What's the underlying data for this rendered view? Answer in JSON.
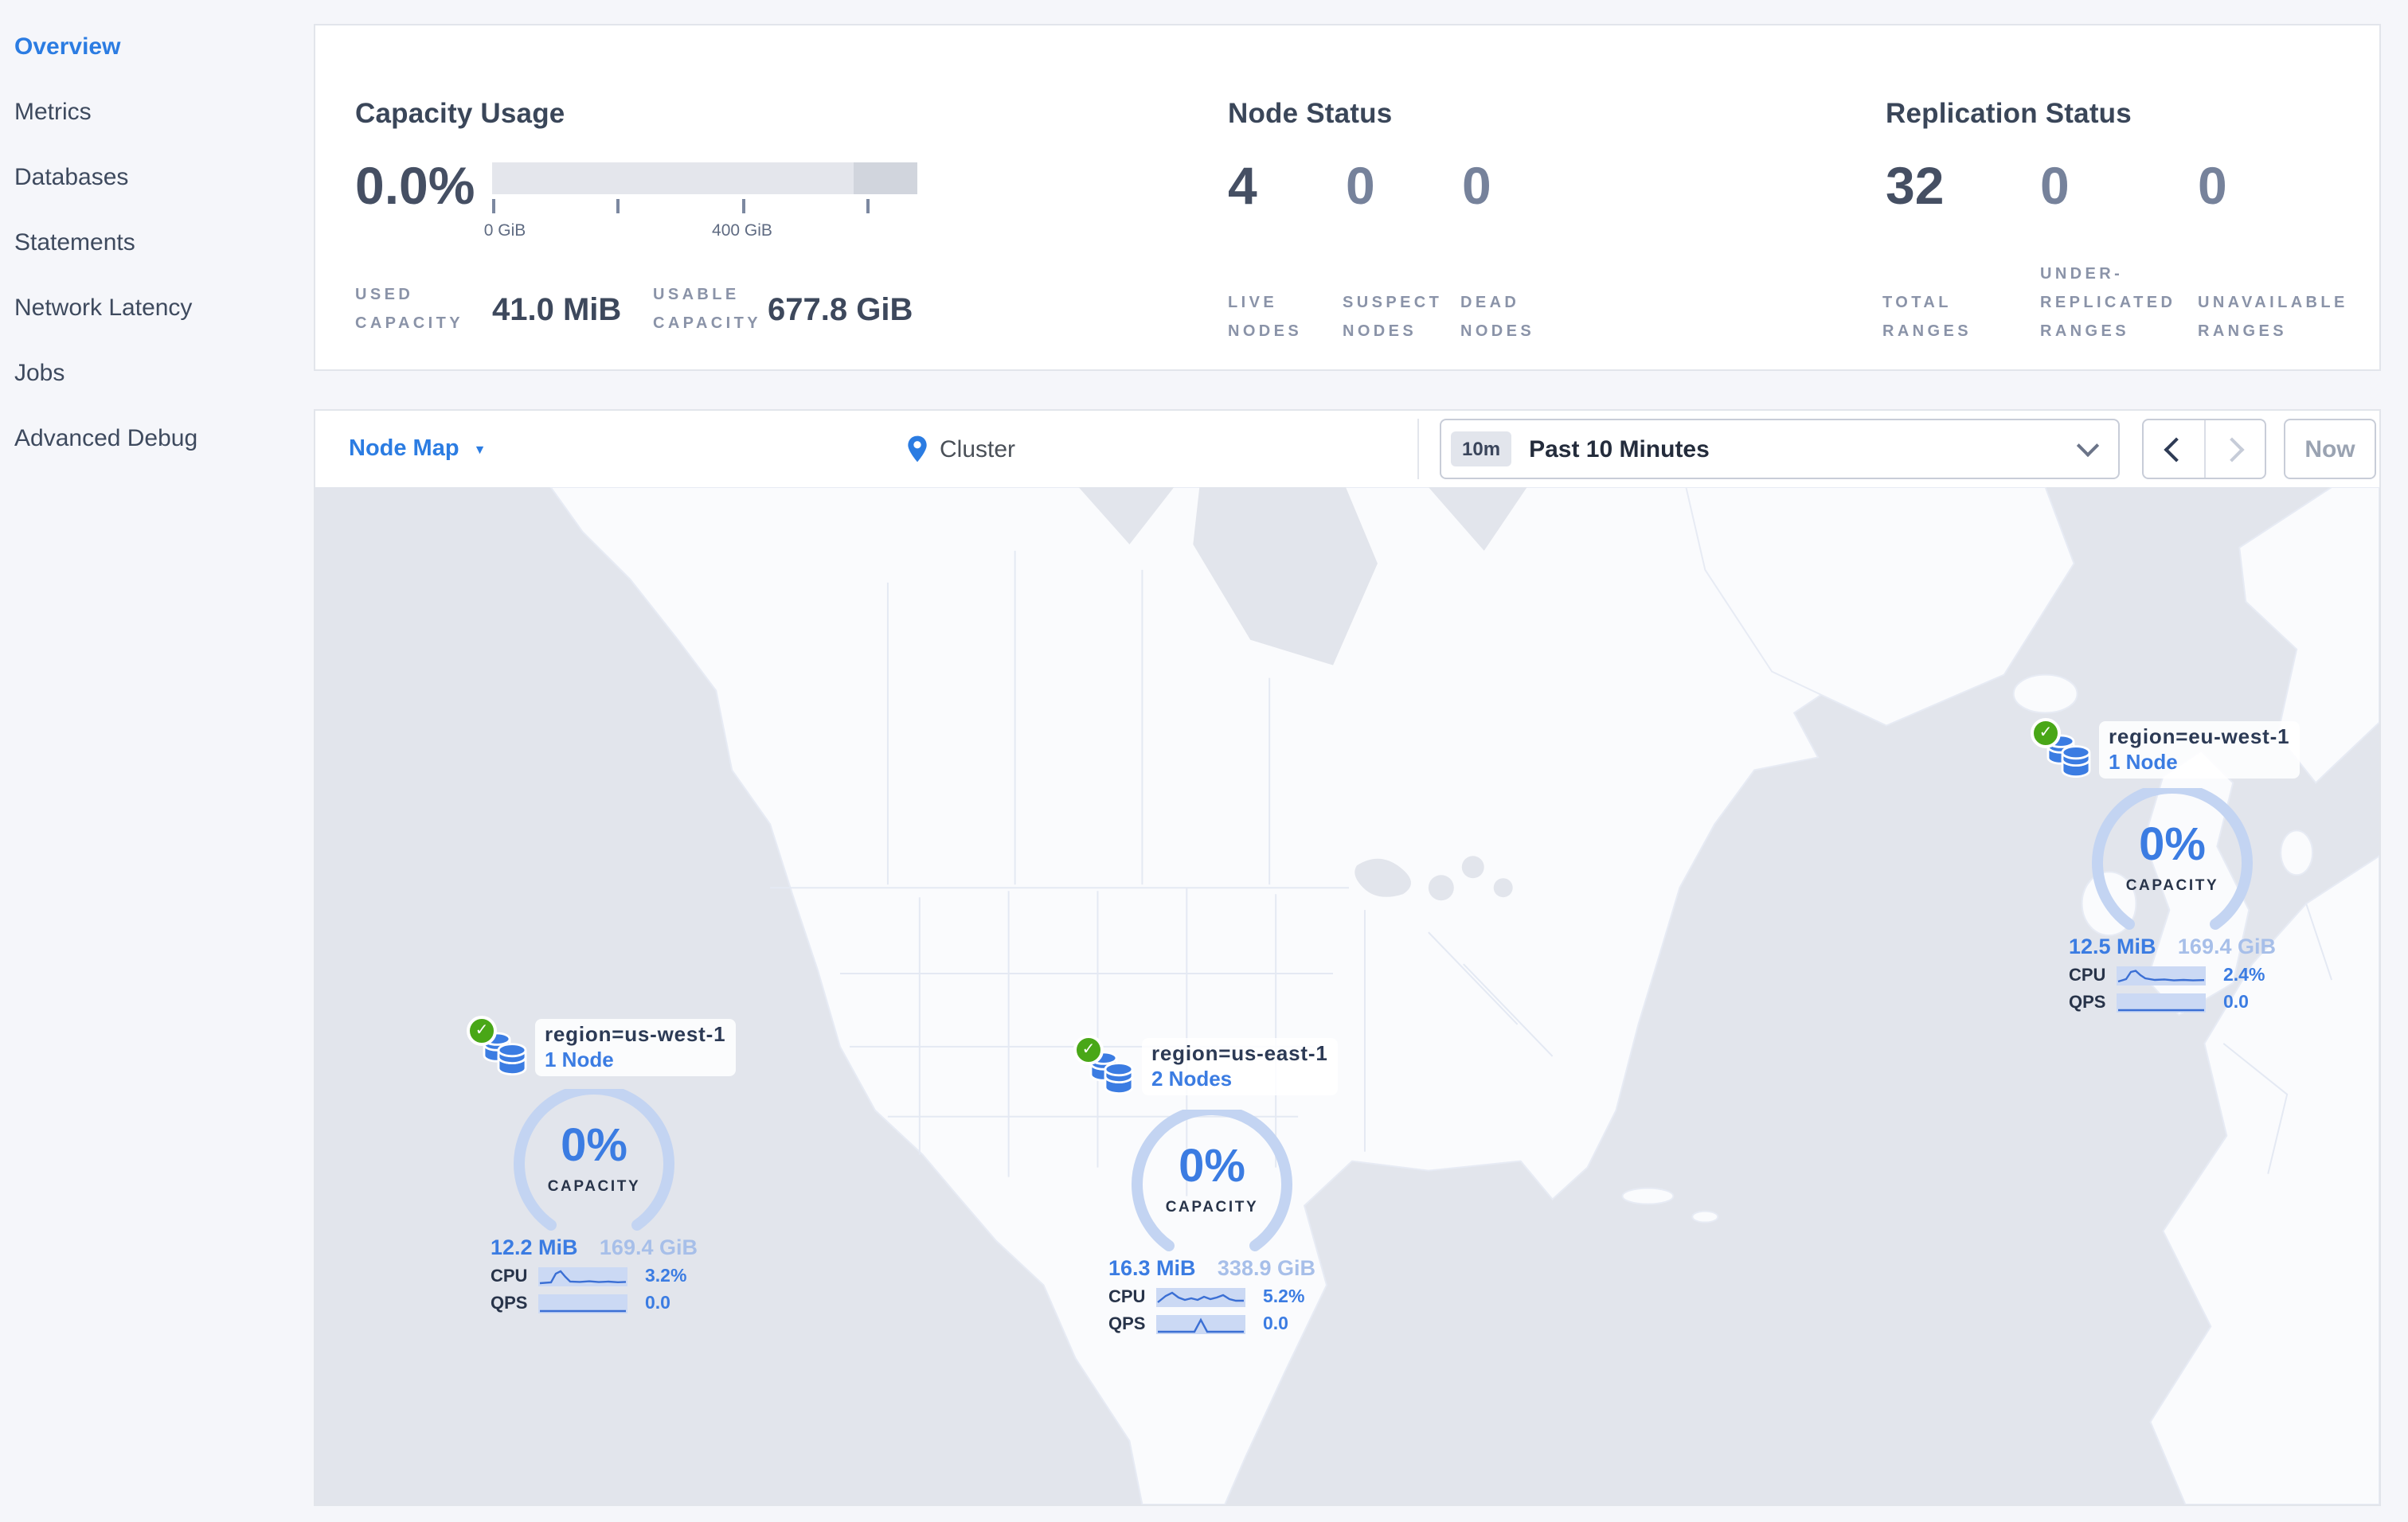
{
  "colors": {
    "accent": "#3b7ce2",
    "accent_light_arc": "#c3d4f2",
    "spark_band": "#cbd9f4",
    "green_check": "#49a717",
    "navy_text": "#3a4659",
    "muted_number": "#76829b",
    "caps_label": "#8a93a8",
    "ocean": "#e2e5ec",
    "land": "#fafbfd",
    "bar_track": "#e4e6ec",
    "bar_extra": "#d1d5dd"
  },
  "sidebar": {
    "items": [
      {
        "label": "Overview",
        "active": true
      },
      {
        "label": "Metrics",
        "active": false
      },
      {
        "label": "Databases",
        "active": false
      },
      {
        "label": "Statements",
        "active": false
      },
      {
        "label": "Network Latency",
        "active": false
      },
      {
        "label": "Jobs",
        "active": false
      },
      {
        "label": "Advanced Debug",
        "active": false
      }
    ]
  },
  "stats": {
    "capacity": {
      "title": "Capacity Usage",
      "percent": "0.0%",
      "tick_labels": [
        "0 GiB",
        "400 GiB"
      ],
      "used": {
        "label": [
          "USED",
          "CAPACITY"
        ],
        "value": "41.0 MiB"
      },
      "usable": {
        "label": [
          "USABLE",
          "CAPACITY"
        ],
        "value": "677.8 GiB"
      }
    },
    "node_status": {
      "title": "Node Status",
      "live": {
        "value": "4",
        "label": [
          "LIVE",
          "NODES"
        ]
      },
      "suspect": {
        "value": "0",
        "label": [
          "SUSPECT",
          "NODES"
        ]
      },
      "dead": {
        "value": "0",
        "label": [
          "DEAD",
          "NODES"
        ]
      }
    },
    "replication": {
      "title": "Replication Status",
      "total": {
        "value": "32",
        "label": [
          "TOTAL",
          "RANGES"
        ]
      },
      "under": {
        "value": "0",
        "label": [
          "UNDER-",
          "REPLICATED",
          "RANGES"
        ]
      },
      "unavailable": {
        "value": "0",
        "label": [
          "UNAVAILABLE",
          "RANGES"
        ]
      }
    }
  },
  "toolbar": {
    "view": "Node Map",
    "breadcrumb": "Cluster",
    "time": {
      "badge": "10m",
      "label": "Past 10 Minutes"
    },
    "now": "Now"
  },
  "map": {
    "nodes": [
      {
        "title": "region=us-west-1",
        "count": "1 Node",
        "percent": "0%",
        "capacity_label": "CAPACITY",
        "used": "12.2 MiB",
        "total": "169.4 GiB",
        "cpu_label": "CPU",
        "cpu_value": "3.2%",
        "qps_label": "QPS",
        "qps_value": "0.0"
      },
      {
        "title": "region=us-east-1",
        "count": "2 Nodes",
        "percent": "0%",
        "capacity_label": "CAPACITY",
        "used": "16.3 MiB",
        "total": "338.9 GiB",
        "cpu_label": "CPU",
        "cpu_value": "5.2%",
        "qps_label": "QPS",
        "qps_value": "0.0"
      },
      {
        "title": "region=eu-west-1",
        "count": "1 Node",
        "percent": "0%",
        "capacity_label": "CAPACITY",
        "used": "12.5 MiB",
        "total": "169.4 GiB",
        "cpu_label": "CPU",
        "cpu_value": "2.4%",
        "qps_label": "QPS",
        "qps_value": "0.0"
      }
    ]
  }
}
